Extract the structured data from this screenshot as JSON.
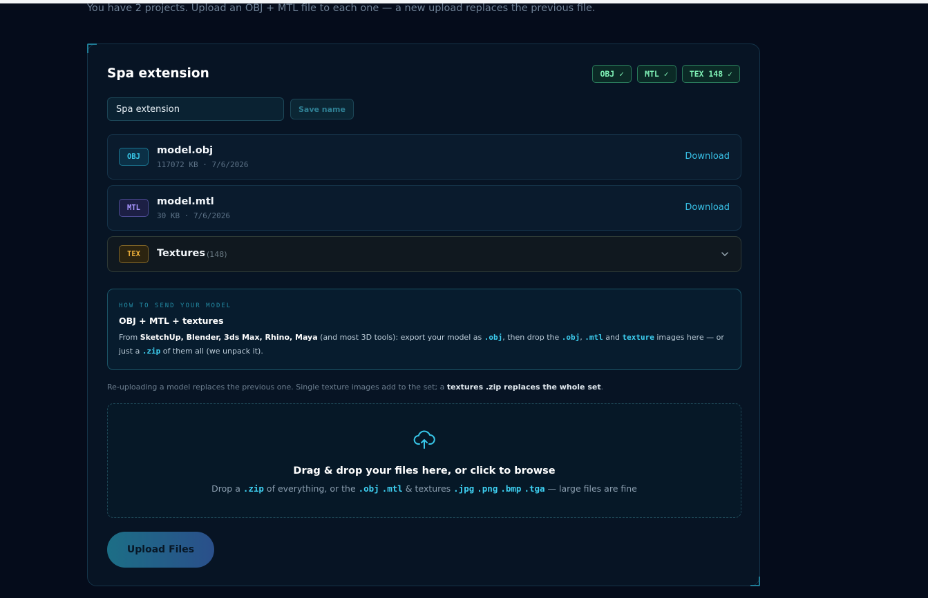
{
  "page": {
    "subtitle": "You have 2 projects. Upload an OBJ + MTL file to each one — a new upload replaces the previous file."
  },
  "project": {
    "title": "Spa extension",
    "badges": [
      "OBJ ✓",
      "MTL ✓",
      "TEX 148 ✓"
    ],
    "name_input_value": "Spa extension",
    "save_label": "Save name"
  },
  "files": {
    "obj": {
      "tag": "OBJ",
      "name": "model.obj",
      "meta": "117072 KB · 7/6/2026",
      "action": "Download"
    },
    "mtl": {
      "tag": "MTL",
      "name": "model.mtl",
      "meta": "30 KB · 7/6/2026",
      "action": "Download"
    },
    "tex": {
      "tag": "TEX",
      "label": "Textures",
      "count": "(148)"
    }
  },
  "info": {
    "kicker": "HOW TO SEND YOUR MODEL",
    "title": "OBJ + MTL + textures",
    "from": "From ",
    "tools": "SketchUp, Blender, 3ds Max, Rhino, Maya",
    "t1": " (and most 3D tools): export your model as ",
    "c_obj": ".obj",
    "t2": ", then drop the ",
    "t3": ", ",
    "c_mtl": ".mtl",
    "t4": " and ",
    "c_texture": "texture",
    "t5": " images here — or just a ",
    "c_zip": ".zip",
    "t6": " of them all (we unpack it)."
  },
  "note": {
    "text": "Re-uploading a model replaces the previous one. Single texture images add to the set; a ",
    "bold": "textures .zip replaces the whole set",
    "end": "."
  },
  "drop": {
    "title": "Drag & drop your files here, or click to browse",
    "s1": "Drop a ",
    "zip": ".zip",
    "s2": " of everything, or the ",
    "obj": ".obj",
    "mtl": ".mtl",
    "s3": " & textures ",
    "jpg": ".jpg",
    "png": ".png",
    "bmp": ".bmp",
    "tga": ".tga",
    "s4": " — large files are fine"
  },
  "upload": {
    "label": "Upload Files"
  },
  "icons": {
    "expand": "chevron-down-icon",
    "upload": "cloud-upload-icon"
  },
  "colors": {
    "accent": "#38c0e6",
    "success": "#7ef0b5",
    "warning": "#f2b43c",
    "mtl": "#a895ff"
  }
}
